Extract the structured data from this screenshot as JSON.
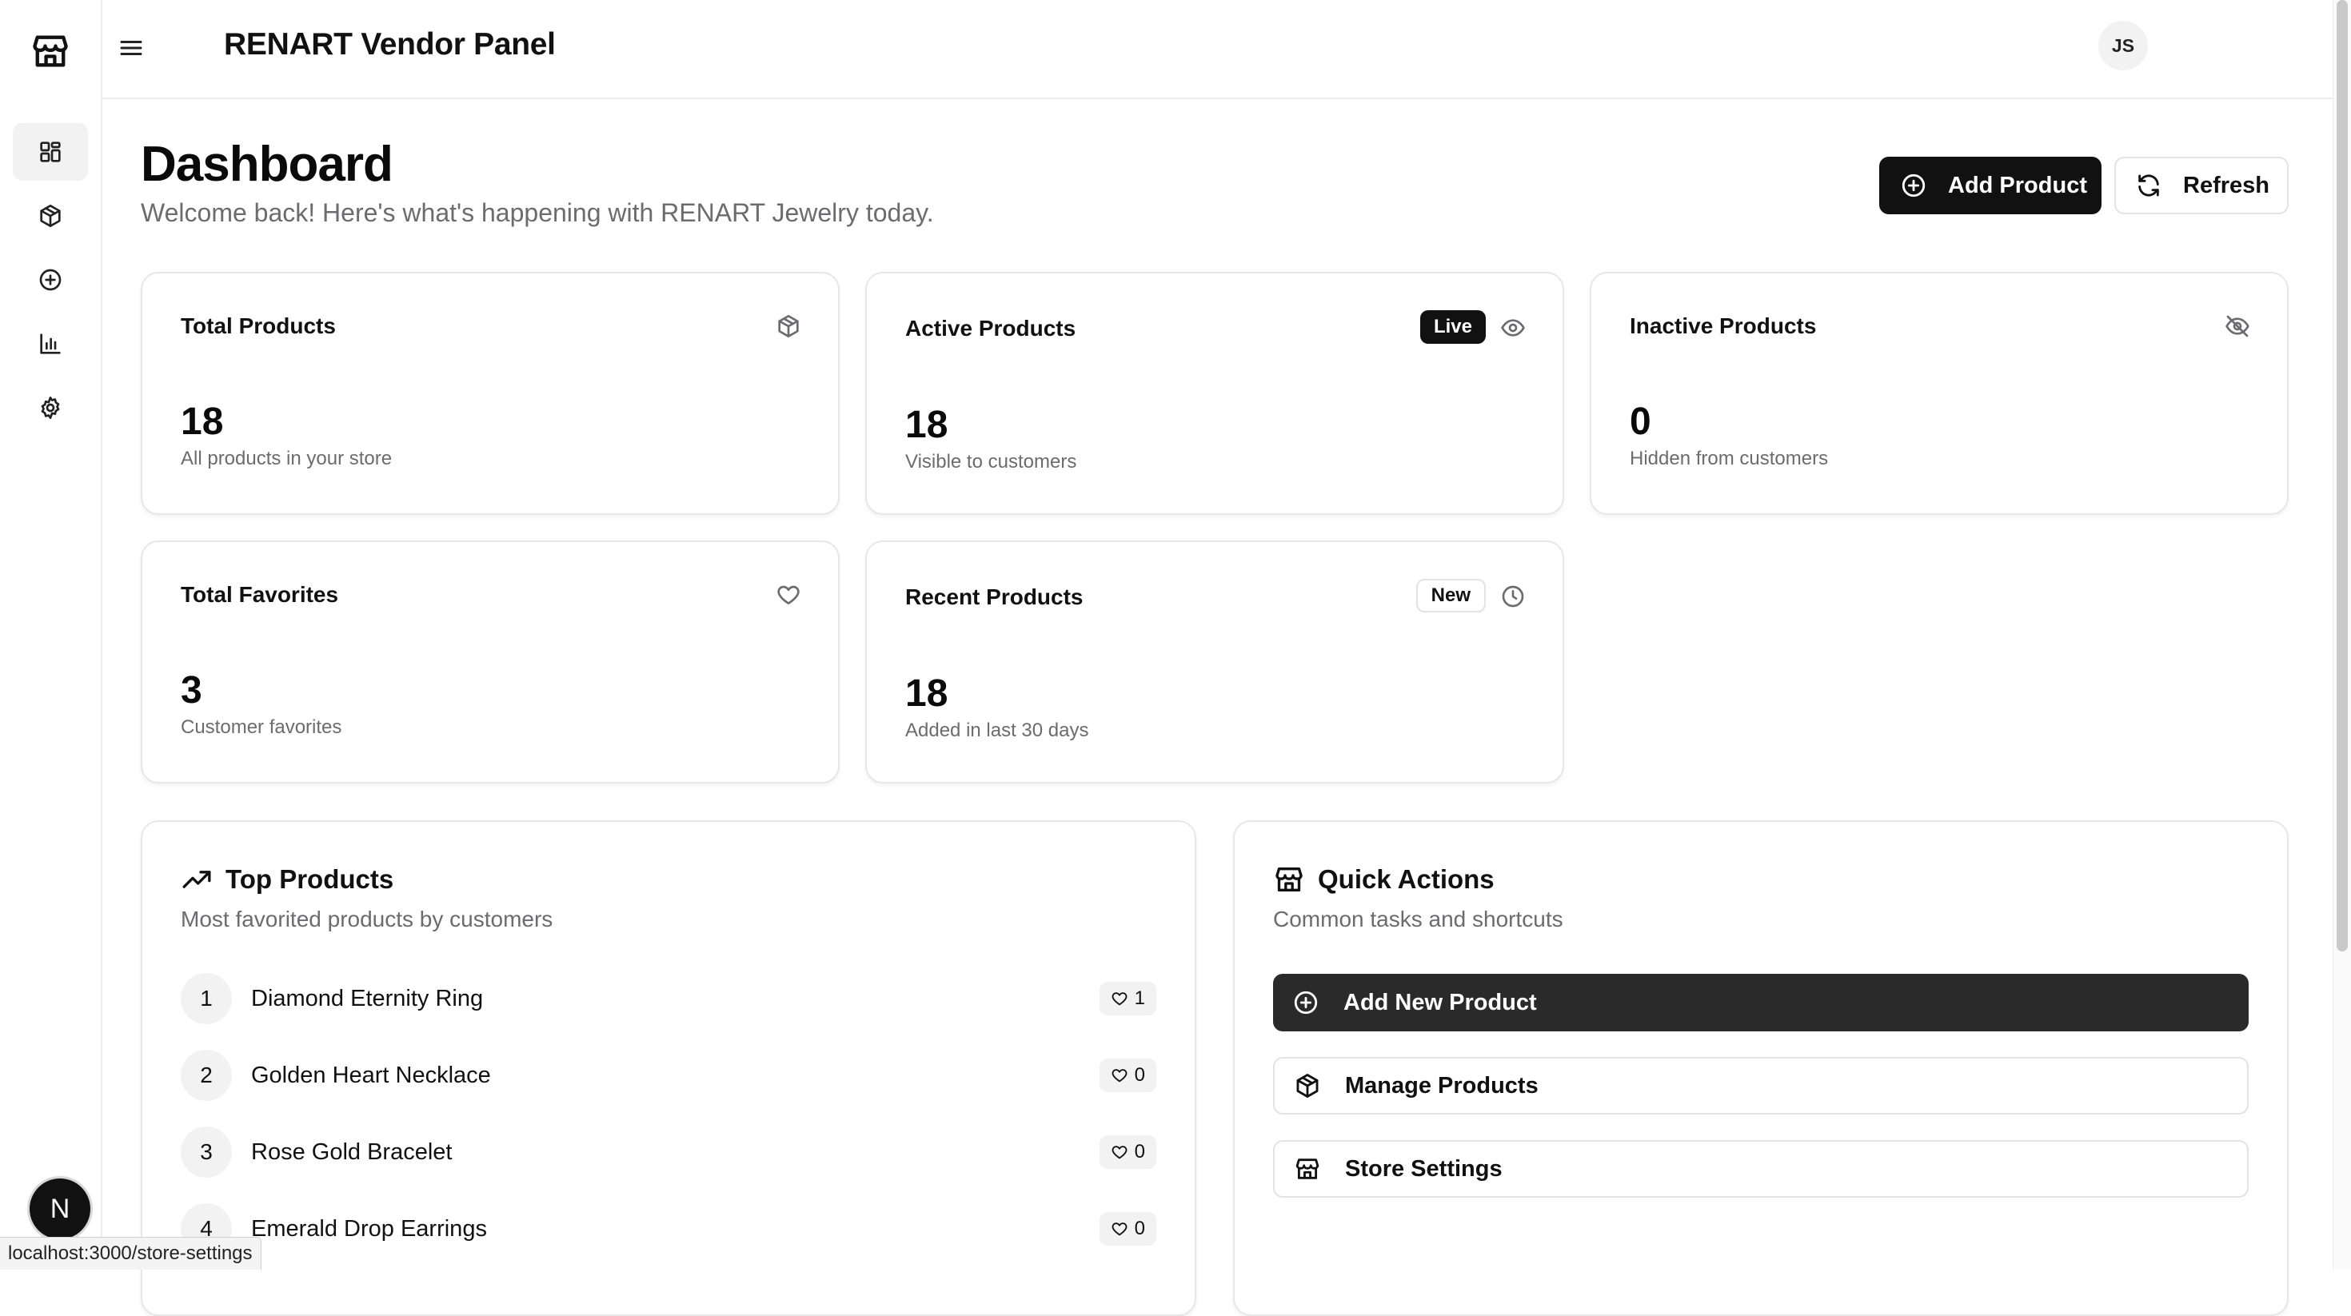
{
  "app": {
    "title": "RENART Vendor Panel",
    "user_initials": "JS"
  },
  "sidebar": {
    "items": [
      {
        "name": "dashboard",
        "icon": "dashboard-icon",
        "active": true
      },
      {
        "name": "products",
        "icon": "package-icon",
        "active": false
      },
      {
        "name": "add-product",
        "icon": "plus-circle-icon",
        "active": false
      },
      {
        "name": "analytics",
        "icon": "bar-chart-icon",
        "active": false
      },
      {
        "name": "settings",
        "icon": "gear-icon",
        "active": false
      }
    ],
    "dev_badge": "N"
  },
  "page": {
    "title": "Dashboard",
    "subtitle": "Welcome back! Here's what's happening with RENART Jewelry today.",
    "add_product_label": "Add Product",
    "refresh_label": "Refresh"
  },
  "stats": {
    "total_products": {
      "title": "Total Products",
      "value": "18",
      "desc": "All products in your store"
    },
    "active_products": {
      "title": "Active Products",
      "badge": "Live",
      "value": "18",
      "desc": "Visible to customers"
    },
    "inactive_products": {
      "title": "Inactive Products",
      "value": "0",
      "desc": "Hidden from customers"
    },
    "total_favorites": {
      "title": "Total Favorites",
      "value": "3",
      "desc": "Customer favorites"
    },
    "recent_products": {
      "title": "Recent Products",
      "badge": "New",
      "value": "18",
      "desc": "Added in last 30 days"
    }
  },
  "top_products": {
    "title": "Top Products",
    "subtitle": "Most favorited products by customers",
    "items": [
      {
        "rank": "1",
        "name": "Diamond Eternity Ring",
        "favorites": "1"
      },
      {
        "rank": "2",
        "name": "Golden Heart Necklace",
        "favorites": "0"
      },
      {
        "rank": "3",
        "name": "Rose Gold Bracelet",
        "favorites": "0"
      },
      {
        "rank": "4",
        "name": "Emerald Drop Earrings",
        "favorites": "0"
      }
    ]
  },
  "quick_actions": {
    "title": "Quick Actions",
    "subtitle": "Common tasks and shortcuts",
    "add_new_product": "Add New Product",
    "manage_products": "Manage Products",
    "store_settings": "Store Settings"
  },
  "status_bar": {
    "url": "localhost:3000/store-settings"
  }
}
